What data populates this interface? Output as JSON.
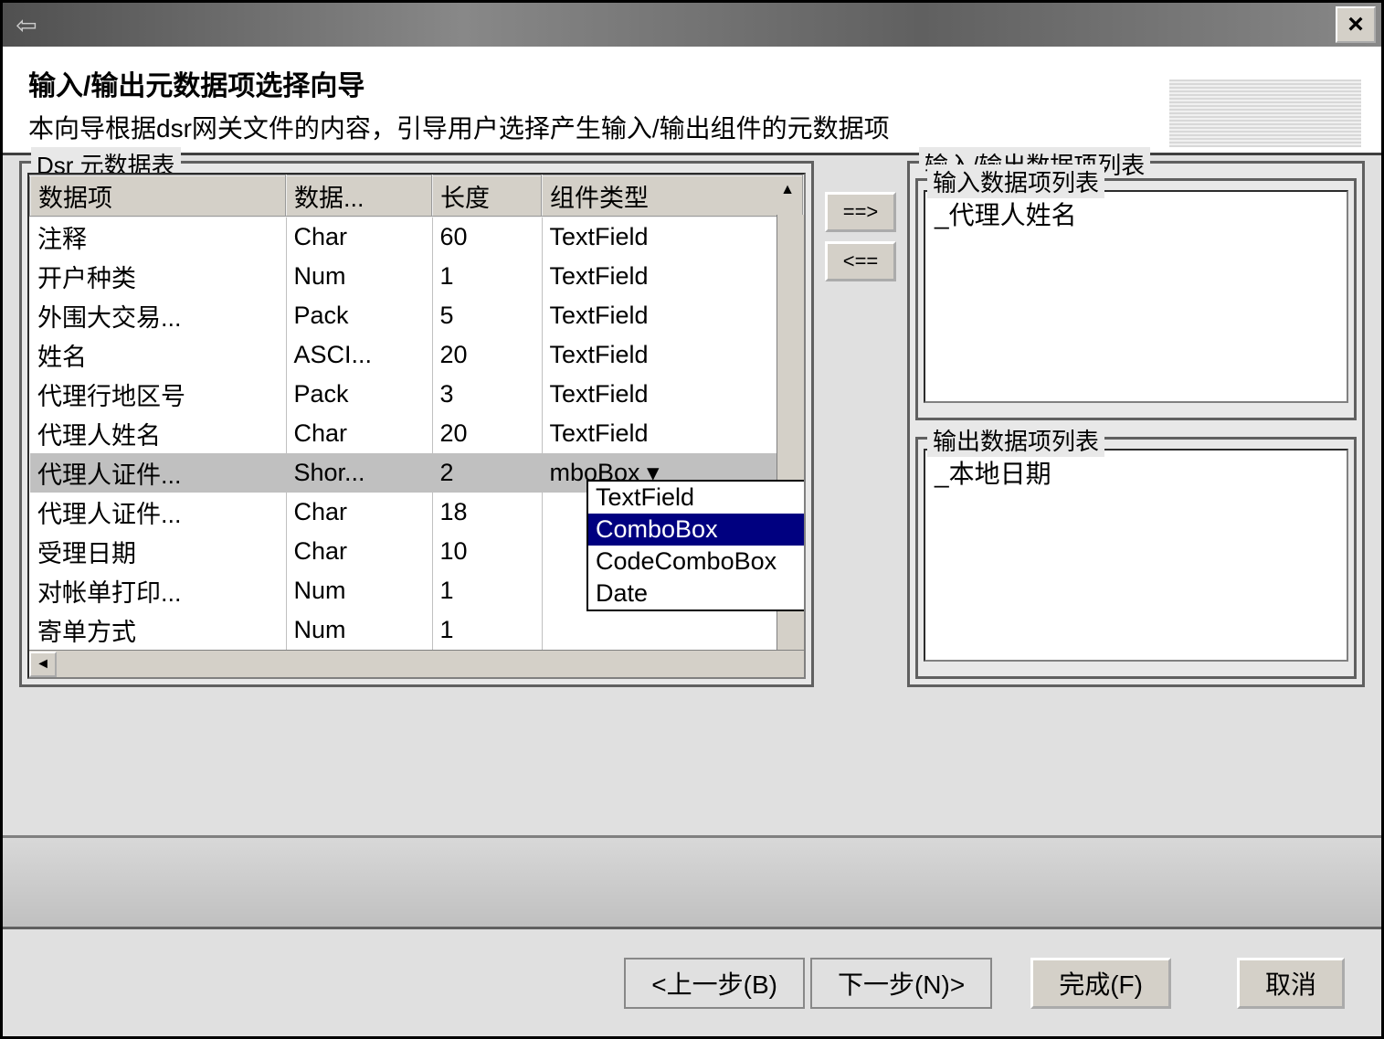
{
  "window": {
    "close_label": "×",
    "back_glyph": "⇦"
  },
  "header": {
    "title": "输入/输出元数据项选择向导",
    "description": "本向导根据dsr网关文件的内容，引导用户选择产生输入/输出组件的元数据项"
  },
  "left": {
    "legend": "Dsr 元数据表",
    "columns": {
      "c0": "数据项",
      "c1": "数据...",
      "c2": "长度",
      "c3": "组件类型"
    },
    "rows": [
      {
        "name": "注释",
        "type": "Char",
        "len": "60",
        "comp": "TextField",
        "sel": false
      },
      {
        "name": "开户种类",
        "type": "Num",
        "len": "1",
        "comp": "TextField",
        "sel": false
      },
      {
        "name": "外围大交易...",
        "type": "Pack",
        "len": "5",
        "comp": "TextField",
        "sel": false
      },
      {
        "name": "姓名",
        "type": "ASCI...",
        "len": "20",
        "comp": "TextField",
        "sel": false
      },
      {
        "name": "代理行地区号",
        "type": "Pack",
        "len": "3",
        "comp": "TextField",
        "sel": false
      },
      {
        "name": "代理人姓名",
        "type": "Char",
        "len": "20",
        "comp": "TextField",
        "sel": false
      },
      {
        "name": "代理人证件...",
        "type": "Shor...",
        "len": "2",
        "comp": "mboBox ▾",
        "sel": true
      },
      {
        "name": "代理人证件...",
        "type": "Char",
        "len": "18",
        "comp": "",
        "sel": false
      },
      {
        "name": "受理日期",
        "type": "Char",
        "len": "10",
        "comp": "",
        "sel": false
      },
      {
        "name": "对帐单打印...",
        "type": "Num",
        "len": "1",
        "comp": "",
        "sel": false
      },
      {
        "name": "寄单方式",
        "type": "Num",
        "len": "1",
        "comp": "",
        "sel": false
      }
    ]
  },
  "dropdown": {
    "options": [
      "TextField",
      "ComboBox",
      "CodeComboBox",
      "Date"
    ],
    "selected_index": 1
  },
  "move": {
    "right": "==>",
    "left": "<=="
  },
  "right": {
    "legend": "输入/输出数据项列表",
    "input_legend": "输入数据项列表",
    "input_items": [
      "_代理人姓名"
    ],
    "output_legend": "输出数据项列表",
    "output_items": [
      "_本地日期"
    ]
  },
  "footer": {
    "back": "<上一步(B)",
    "next": "下一步(N)>",
    "finish": "完成(F)",
    "cancel": "取消"
  }
}
